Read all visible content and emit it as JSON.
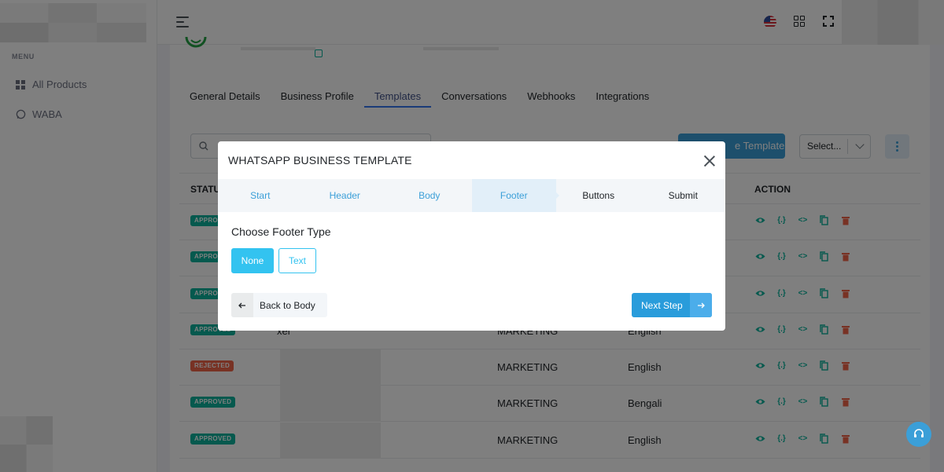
{
  "sidebar": {
    "menu_label": "MENU",
    "items": [
      {
        "label": "All Products",
        "icon": "grid-icon"
      },
      {
        "label": "WABA",
        "icon": "whatsapp-icon"
      }
    ]
  },
  "topbar": {
    "language_icon": "us-flag-icon",
    "apps_icon": "apps-grid-icon",
    "fullscreen_icon": "fullscreen-icon"
  },
  "tabs": [
    {
      "label": "General Details"
    },
    {
      "label": "Business Profile"
    },
    {
      "label": "Templates",
      "active": true
    },
    {
      "label": "Conversations"
    },
    {
      "label": "Webhooks"
    },
    {
      "label": "Integrations"
    }
  ],
  "toolbar": {
    "create_label": "e Template",
    "select_placeholder": "Select..."
  },
  "table": {
    "headers": {
      "status": "STATUS",
      "action": "ACTION"
    },
    "rows": [
      {
        "status": "APPROVED",
        "name": "",
        "category": "",
        "language": ""
      },
      {
        "status": "APPROVED",
        "name": "",
        "category": "",
        "language": ""
      },
      {
        "status": "APPROVED",
        "name": "",
        "category": "",
        "language": ""
      },
      {
        "status": "APPROVED",
        "name": "xel",
        "category": "MARKETING",
        "language": "English"
      },
      {
        "status": "REJECTED",
        "name": "",
        "category": "MARKETING",
        "language": "English"
      },
      {
        "status": "APPROVED",
        "name": "",
        "category": "MARKETING",
        "language": "Bengali"
      },
      {
        "status": "APPROVED",
        "name": "",
        "category": "MARKETING",
        "language": "English"
      }
    ]
  },
  "modal": {
    "title": "WHATSAPP BUSINESS TEMPLATE",
    "steps": [
      {
        "label": "Start",
        "state": "done"
      },
      {
        "label": "Header",
        "state": "done"
      },
      {
        "label": "Body",
        "state": "done"
      },
      {
        "label": "Footer",
        "state": "active"
      },
      {
        "label": "Buttons",
        "state": "pending"
      },
      {
        "label": "Submit",
        "state": "pending"
      }
    ],
    "prompt": "Choose Footer Type",
    "options": {
      "none": "None",
      "text": "Text"
    },
    "selected_option": "None",
    "back_label": "Back to Body",
    "next_label": "Next Step"
  },
  "colors": {
    "accent": "#3b9fd8",
    "approved": "#0ab39c",
    "rejected": "#f06548",
    "option_active": "#33c3f0"
  }
}
